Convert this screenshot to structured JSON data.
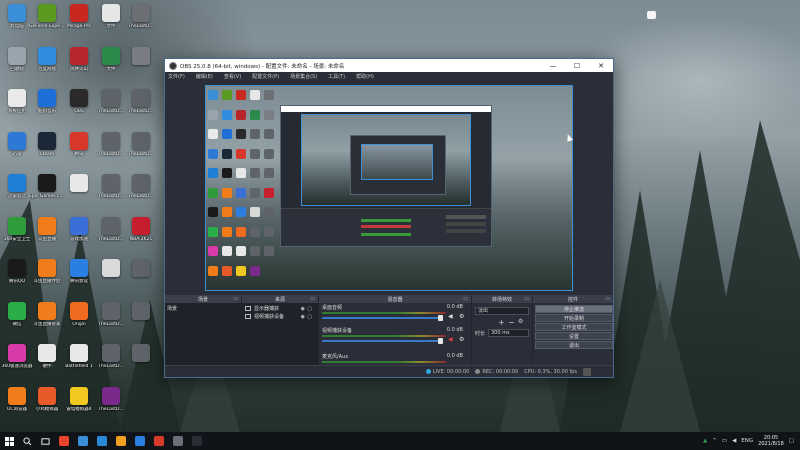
{
  "desktop": {
    "icons": [
      {
        "label": "此电脑",
        "color": "#3a8fd8",
        "col": 0,
        "row": 0
      },
      {
        "label": "GeForce Experience",
        "color": "#5a9a1f",
        "col": 1,
        "row": 0
      },
      {
        "label": "Mirage Pro",
        "color": "#c8281f",
        "col": 2,
        "row": 0
      },
      {
        "label": "文件",
        "color": "#e6e6e6",
        "col": 3,
        "row": 0
      },
      {
        "label": "TheLastD...",
        "color": "#6b6f74",
        "col": 4,
        "row": 0
      },
      {
        "label": "回收站",
        "color": "#9aa4ad",
        "col": 0,
        "row": 1
      },
      {
        "label": "百度网盘",
        "color": "#2f8de0",
        "col": 1,
        "row": 1
      },
      {
        "label": "风林火山",
        "color": "#b8262b",
        "col": 2,
        "row": 1
      },
      {
        "label": "文件",
        "color": "#2c8a4a",
        "col": 3,
        "row": 1
      },
      {
        "label": "",
        "color": "#7a7e84",
        "col": 4,
        "row": 1
      },
      {
        "label": "系统应用",
        "color": "#e9e9e9",
        "col": 0,
        "row": 2
      },
      {
        "label": "酷狗音乐",
        "color": "#1f6fd8",
        "col": 1,
        "row": 2
      },
      {
        "label": "OBS",
        "color": "#2a2a2a",
        "col": 2,
        "row": 2
      },
      {
        "label": "TheLastD...",
        "color": "#5e646a",
        "col": 3,
        "row": 2
      },
      {
        "label": "TheLastD...",
        "color": "#5e646a",
        "col": 4,
        "row": 2
      },
      {
        "label": "迅雷",
        "color": "#2e79d6",
        "col": 0,
        "row": 3
      },
      {
        "label": "Steam",
        "color": "#1b2838",
        "col": 1,
        "row": 3
      },
      {
        "label": "腾讯",
        "color": "#d8382b",
        "col": 2,
        "row": 3
      },
      {
        "label": "TheLastD...",
        "color": "#5e646a",
        "col": 3,
        "row": 3
      },
      {
        "label": "TheLastD...",
        "color": "#5e646a",
        "col": 4,
        "row": 3
      },
      {
        "label": "迅雷影音",
        "color": "#1f7fd6",
        "col": 0,
        "row": 4
      },
      {
        "label": "Epic Games Launcher",
        "color": "#1a1a1a",
        "col": 1,
        "row": 4
      },
      {
        "label": "",
        "color": "#e8e8e8",
        "col": 2,
        "row": 4
      },
      {
        "label": "TheLastD...",
        "color": "#5e646a",
        "col": 3,
        "row": 4
      },
      {
        "label": "TheLastD...",
        "color": "#5e646a",
        "col": 4,
        "row": 4
      },
      {
        "label": "360安全卫士",
        "color": "#2f9b3a",
        "col": 0,
        "row": 5
      },
      {
        "label": "斗鱼直播",
        "color": "#f07d1a",
        "col": 1,
        "row": 5
      },
      {
        "label": "游戏加速",
        "color": "#3a6fd8",
        "col": 2,
        "row": 5
      },
      {
        "label": "TheLastD...",
        "color": "#5e646a",
        "col": 3,
        "row": 5
      },
      {
        "label": "NBA 2K21",
        "color": "#c81f2f",
        "col": 4,
        "row": 5
      },
      {
        "label": "腾讯QQ",
        "color": "#1a1a1a",
        "col": 0,
        "row": 6
      },
      {
        "label": "斗鱼直播伴侣",
        "color": "#f07d1a",
        "col": 1,
        "row": 6
      },
      {
        "label": "腾讯会议",
        "color": "#2a7fe0",
        "col": 2,
        "row": 6
      },
      {
        "label": "",
        "color": "#d9d9d9",
        "col": 3,
        "row": 6
      },
      {
        "label": "",
        "color": "#5e646a",
        "col": 4,
        "row": 6
      },
      {
        "label": "微信",
        "color": "#2aae4a",
        "col": 0,
        "row": 7
      },
      {
        "label": "斗鱼直播管家",
        "color": "#f07d1a",
        "col": 1,
        "row": 7
      },
      {
        "label": "Origin",
        "color": "#f06a1f",
        "col": 2,
        "row": 7
      },
      {
        "label": "TheLastD...",
        "color": "#5e646a",
        "col": 3,
        "row": 7
      },
      {
        "label": "",
        "color": "#5e646a",
        "col": 4,
        "row": 7
      },
      {
        "label": "360极速浏览器",
        "color": "#d83aa8",
        "col": 0,
        "row": 8
      },
      {
        "label": "硬件",
        "color": "#e8e8e8",
        "col": 1,
        "row": 8
      },
      {
        "label": "Battlefield 1",
        "color": "#e8e8e8",
        "col": 2,
        "row": 8
      },
      {
        "label": "TheLastD...",
        "color": "#5e646a",
        "col": 3,
        "row": 8
      },
      {
        "label": "",
        "color": "#5e646a",
        "col": 4,
        "row": 8
      },
      {
        "label": "UC浏览器",
        "color": "#f07d1a",
        "col": 0,
        "row": 9
      },
      {
        "label": "小鸡模拟器",
        "color": "#e85a2a",
        "col": 1,
        "row": 9
      },
      {
        "label": "雷电模拟器4",
        "color": "#f0c81f",
        "col": 2,
        "row": 9
      },
      {
        "label": "TheLastD...",
        "color": "#7a2a8a",
        "col": 3,
        "row": 9
      }
    ]
  },
  "obs": {
    "title": "OBS 25.0.8 (64-bit, windows) - 配置文件: 未命名 - 场景: 未命名",
    "menus": [
      "文件(F)",
      "编辑(E)",
      "查看(V)",
      "配置文件(P)",
      "场景集合(S)",
      "工具(T)",
      "帮助(H)"
    ],
    "window_buttons": {
      "minimize": "—",
      "maximize": "☐",
      "close": "✕"
    },
    "docks": {
      "scenes": {
        "title": "场景",
        "items": [
          "场景"
        ]
      },
      "sources": {
        "title": "来源",
        "items": [
          "显示器捕获",
          "视频捕获设备"
        ]
      },
      "mixer": {
        "title": "混音器",
        "channels": [
          {
            "name": "桌面音频",
            "db": "0.0 dB"
          },
          {
            "name": "视频捕获设备",
            "db": "0.0 dB"
          },
          {
            "name": "麦克风/Aux",
            "db": "0.0 dB"
          }
        ]
      },
      "transitions": {
        "title": "转场特效",
        "type": "淡出",
        "duration_label": "时长",
        "duration": "300 ms"
      },
      "controls": {
        "title": "控件",
        "buttons": [
          "停止推流",
          "开始录制",
          "工作室模式",
          "设置",
          "退出"
        ]
      }
    },
    "status": {
      "live_label": "LIVE:",
      "live_time": "00:00:00",
      "rec_label": "REC:",
      "rec_time": "00:00:00",
      "cpu": "CPU: 0.3%, 30.00 fps"
    }
  },
  "taskbar": {
    "start_icon": "windows-icon",
    "search_icon": "search-icon",
    "apps": [
      "#e8452b",
      "#3a8fd8",
      "#2a8ad8",
      "#f0a01f",
      "#2a7fe0",
      "#d83a2a",
      "#6a6f7a",
      "#2a2d35"
    ],
    "tray_lang": "ENG",
    "time": "20:05",
    "date": "2021/8/18"
  }
}
